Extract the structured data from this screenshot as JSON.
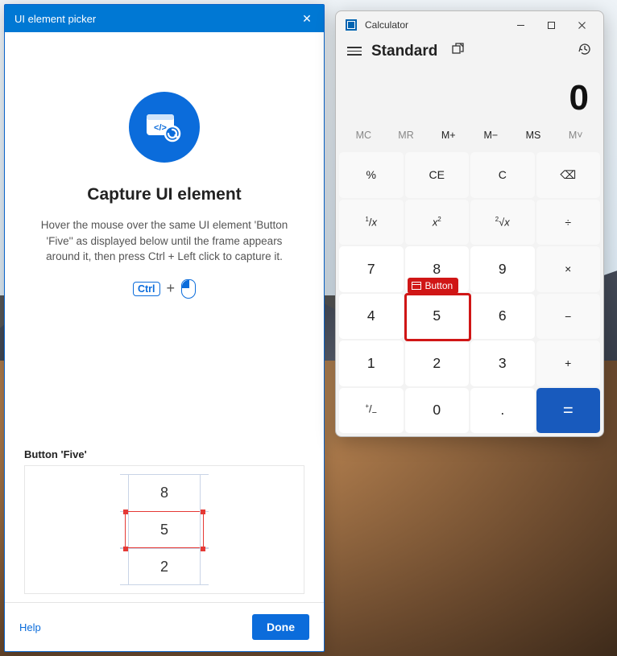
{
  "picker": {
    "title": "UI element picker",
    "heading": "Capture UI element",
    "description": "Hover the mouse over the same UI element 'Button 'Five'' as displayed below until the frame appears around it, then press Ctrl + Left click to capture it.",
    "ctrl_label": "Ctrl",
    "preview_label": "Button 'Five'",
    "preview_cells": {
      "top": "8",
      "mid": "5",
      "bottom": "2"
    },
    "help_label": "Help",
    "done_label": "Done"
  },
  "calc": {
    "app_title": "Calculator",
    "mode": "Standard",
    "display": "0",
    "memory": {
      "mc": "MC",
      "mr": "MR",
      "mplus": "M+",
      "mminus": "M−",
      "ms": "MS",
      "mlist": "M˅"
    },
    "keys": {
      "percent": "%",
      "ce": "CE",
      "c": "C",
      "back": "⌫",
      "recip": "¹⁄ₓ",
      "square": "x²",
      "sqrt": "²√x",
      "div": "÷",
      "d7": "7",
      "d8": "8",
      "d9": "9",
      "mul": "×",
      "d4": "4",
      "d5": "5",
      "d6": "6",
      "sub": "−",
      "d1": "1",
      "d2": "2",
      "d3": "3",
      "add": "+",
      "neg": "⁺⁄₋",
      "d0": "0",
      "dot": ".",
      "eq": "="
    },
    "tooltip": "Button"
  }
}
